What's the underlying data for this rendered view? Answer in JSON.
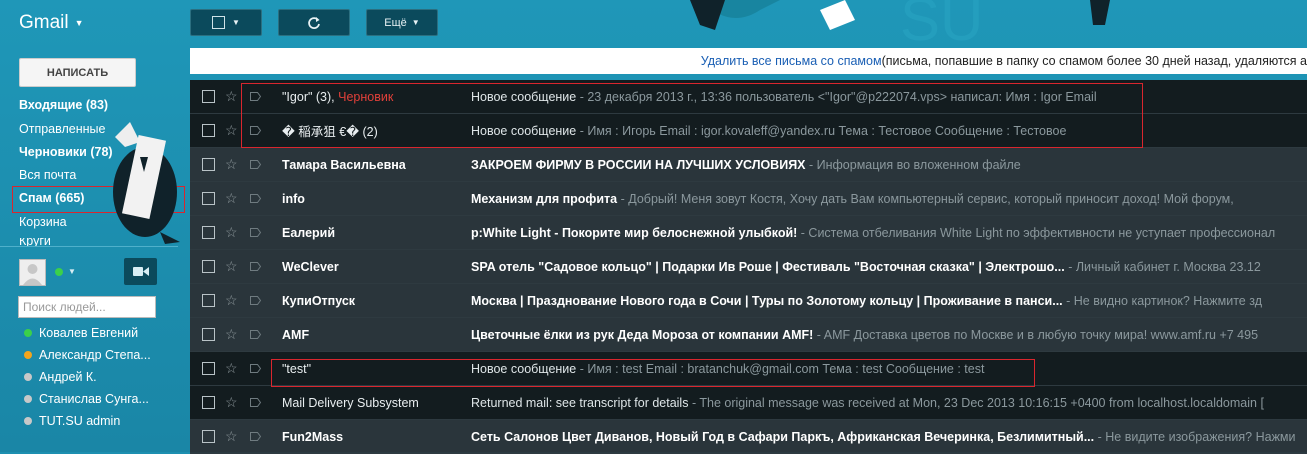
{
  "header": {
    "app_name": "Gmail",
    "more_button": "Ещё"
  },
  "sidebar": {
    "compose_label": "НАПИСАТЬ",
    "items": [
      {
        "label": "Входящие (83)",
        "bold": true
      },
      {
        "label": "Отправленные",
        "bold": false
      },
      {
        "label": "Черновики (78)",
        "bold": true
      },
      {
        "label": "Вся почта",
        "bold": false
      },
      {
        "label": "Спам (665)",
        "bold": true
      },
      {
        "label": "Корзина",
        "bold": false
      },
      {
        "label": "Круги",
        "bold": false
      }
    ],
    "people_search_placeholder": "Поиск людей...",
    "contacts": [
      {
        "name": "Ковалев Евгений",
        "status_color": "#3bd04a"
      },
      {
        "name": "Александр Степа...",
        "status_color": "#f2a51c"
      },
      {
        "name": "Андрей К.",
        "status_color": "#c8c8c8"
      },
      {
        "name": "Станислав Сунга...",
        "status_color": "#c8c8c8"
      },
      {
        "name": "TUT.SU admin",
        "status_color": "#c8c8c8"
      }
    ]
  },
  "notice": {
    "link": "Удалить все письма со спамом",
    "text": " (письма, попавшие в папку со спамом более 30 дней назад, удаляются а"
  },
  "emails": [
    {
      "sender": "\"Igor\" (3), ",
      "draft": "Черновик",
      "subject": "Новое сообщение",
      "snippet": " - 23 декабря 2013 г., 13:36 пользователь <\"Igor\"@p222074.vps> написал: Имя : Igor Email",
      "unread": false
    },
    {
      "sender": "� 稲承狙 €� (2)",
      "draft": "",
      "subject": "Новое сообщение",
      "snippet": " - Имя : Игорь Email : igor.kovaleff@yandex.ru Тема : Тестовое Сообщение : Тестовое",
      "unread": false
    },
    {
      "sender": "Тамара Васильевна",
      "draft": "",
      "subject": "ЗАКРОЕМ ФИРМУ В РОССИИ НА ЛУЧШИХ УСЛОВИЯХ",
      "snippet": " - Информация во вложенном файле",
      "unread": true
    },
    {
      "sender": "info",
      "draft": "",
      "subject": "Механизм для профита",
      "snippet": " - Добрый! Меня зовут Костя, Хочу дать Вам компьютерный сервис, который приносит доход! Мой форум,",
      "unread": true
    },
    {
      "sender": "Еалерий",
      "draft": "",
      "subject": "p:White Light - Покорите мир белоснежной улыбкой!",
      "snippet": " - Система отбеливания White Light по эффективности не уступает профессионал",
      "unread": true
    },
    {
      "sender": "WeClever",
      "draft": "",
      "subject": "SPA отель \"Садовое кольцо\" | Подарки Ив Роше | Фестиваль \"Восточная сказка\" | Электрошо...",
      "snippet": " - Личный кабинет г. Москва 23.12",
      "unread": true
    },
    {
      "sender": "КупиОтпуск",
      "draft": "",
      "subject": "Москва | Празднование Нового года в Сочи | Туры по Золотому кольцу | Проживание в панси...",
      "snippet": " - Не видно картинок? Нажмите зд",
      "unread": true
    },
    {
      "sender": "AMF",
      "draft": "",
      "subject": "Цветочные ёлки из рук Деда Мороза от компании AMF!",
      "snippet": " - AMF Доставка цветов по Москве и в любую точку мира! www.amf.ru +7 495",
      "unread": true
    },
    {
      "sender": "\"test\"",
      "draft": "",
      "subject": "Новое сообщение",
      "snippet": " - Имя : test Email : bratanchuk@gmail.com Тема : test Сообщение : test",
      "unread": false
    },
    {
      "sender": "Mail Delivery Subsystem",
      "draft": "",
      "subject": "Returned mail: see transcript for details",
      "snippet": " - The original message was received at Mon, 23 Dec 2013 10:16:15 +0400 from localhost.localdomain [",
      "unread": false
    },
    {
      "sender": "Fun2Mass",
      "draft": "",
      "subject": "Сеть Салонов Цвет Диванов, Новый Год в Сафари Паркъ, Африканская Вечеринка, Безлимитный...",
      "snippet": " - Не видите изображения? Нажми",
      "unread": true
    }
  ],
  "colors": {
    "highlight": "#d9262e",
    "accent_bg": "#1d8fb0",
    "link": "#1a5fb4"
  }
}
